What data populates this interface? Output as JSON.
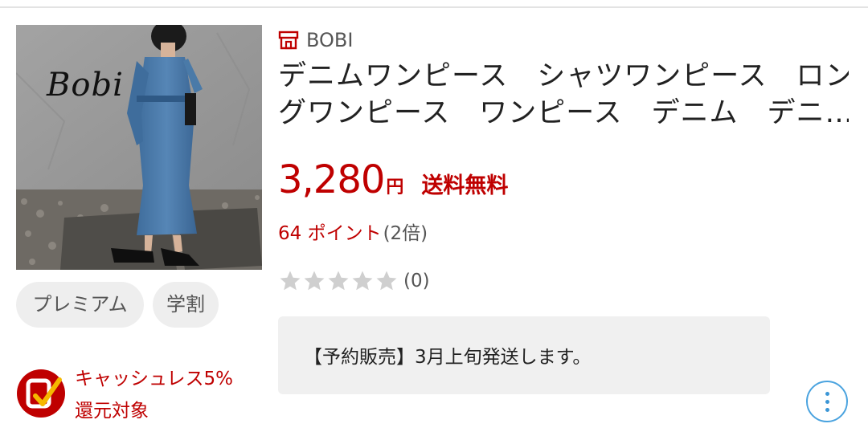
{
  "product": {
    "image_brand_text": "Bobi",
    "shop_icon": "shop-icon",
    "shop_name": "BOBI",
    "title_line1": "デニムワンピース　シャツワンピース　ロン",
    "title_line2": "グワンピース　ワンピース　デニム　デニ…",
    "price": "3,280",
    "price_unit": "円",
    "shipping": "送料無料",
    "points_value": "64 ポイント",
    "points_multiplier": "(2倍)",
    "rating_stars": 0,
    "review_count": "(0)",
    "notice": "【予約販売】3月上旬発送します。"
  },
  "tags": {
    "premium": "プレミアム",
    "student": "学割"
  },
  "cashless": {
    "icon": "cashless-check-icon",
    "line1": "キャッシュレス5%",
    "line2": "還元対象"
  },
  "more_button": {
    "icon": "more-vertical-icon"
  },
  "colors": {
    "accent": "#bf0000",
    "muted_text": "#555555",
    "tag_bg": "#eeeeee",
    "notice_bg": "#f0f0f0",
    "link_blue": "#3b96d6",
    "star_empty": "#cfcfcf"
  }
}
